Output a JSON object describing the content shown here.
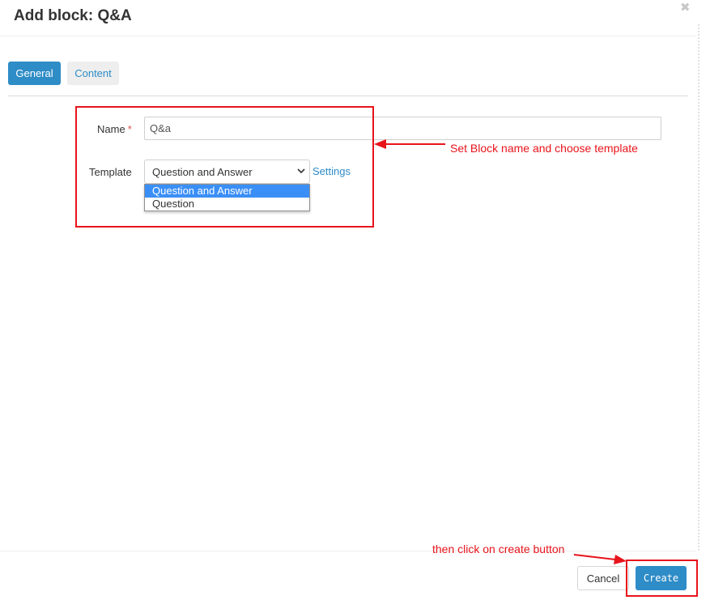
{
  "dialog": {
    "title": "Add block: Q&A",
    "close_glyph": "✖"
  },
  "tabs": [
    {
      "label": "General",
      "active": true
    },
    {
      "label": "Content",
      "active": false
    }
  ],
  "form": {
    "name_label": "Name",
    "required_marker": "*",
    "name_value": "Q&a",
    "template_label": "Template",
    "template_selected": "Question and Answer",
    "template_options": [
      "Question and Answer",
      "Question"
    ],
    "settings_link": "Settings"
  },
  "annotations": {
    "form_note": "Set Block name and choose template",
    "create_note": "then click on create button",
    "color": "#e8141b"
  },
  "footer": {
    "cancel_label": "Cancel",
    "create_label": "Create"
  },
  "colors": {
    "primary": "#2e8cc7",
    "option_highlight": "#3a8ff7",
    "required": "#d9534f"
  }
}
